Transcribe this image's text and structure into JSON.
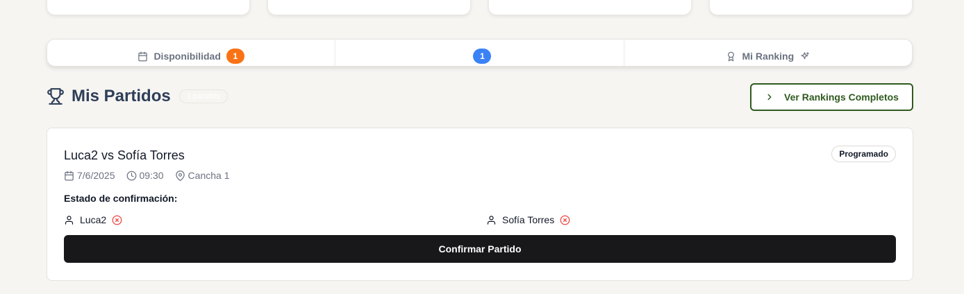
{
  "tabs": [
    {
      "label": "Disponibilidad",
      "badge": "1",
      "badge_color": "#f97316",
      "icon": "calendar-icon"
    },
    {
      "label": "",
      "badge": "1",
      "badge_color": "#3b82f6",
      "icon": ""
    },
    {
      "label": "Mi Ranking",
      "badge": "",
      "icon": "award-icon"
    }
  ],
  "section": {
    "title": "Mis Partidos",
    "count": "1 partidos",
    "rankings_button": "Ver Rankings Completos"
  },
  "match": {
    "title": "Luca2 vs Sofía Torres",
    "status": "Programado",
    "date": "7/6/2025",
    "time": "09:30",
    "court": "Cancha 1",
    "confirmation_label": "Estado de confirmación:",
    "players": [
      {
        "name": "Luca2",
        "confirmed": false
      },
      {
        "name": "Sofía Torres",
        "confirmed": false
      }
    ],
    "confirm_button": "Confirmar Partido"
  },
  "colors": {
    "accent_green": "#2f5a1f",
    "title_navy": "#2e3e57",
    "error_red": "#ef4444"
  }
}
